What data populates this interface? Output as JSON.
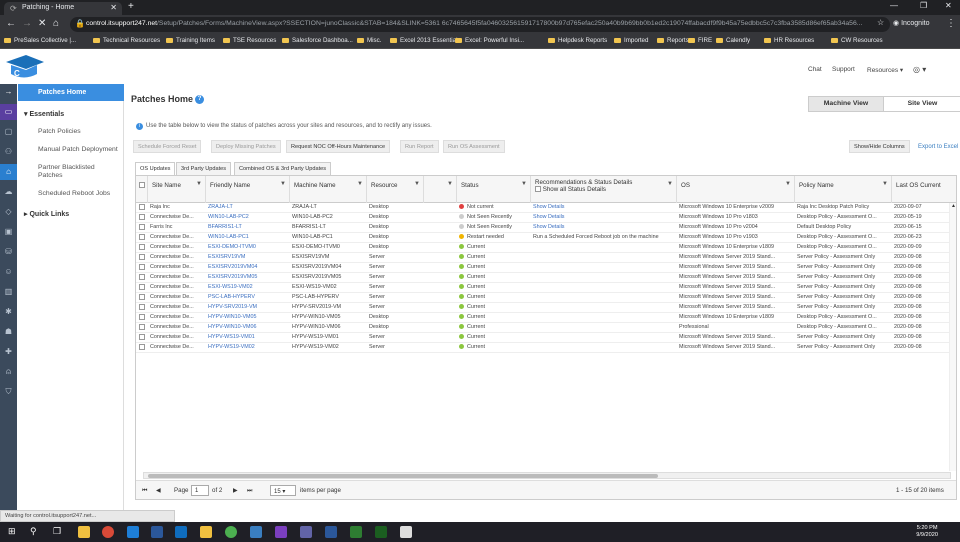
{
  "browser": {
    "tab_title": "Patching - Home",
    "tab_icon": "loading-icon",
    "new_tab_label": "+",
    "url_host": "control.itsupport247.net",
    "url_path": "/Setup/Patches/Forms/MachineView.aspx?SSECTION=junoClassic&STAB=184&SLINK=5361 6c7465645f5fa046032561591717800b97d765efac250a40b9b69bb0b1ed2c19074ffabacdf9f9b45a75edbbc5c7c3fba3585d86ef65ab34a56...",
    "profile": "Incognito",
    "bookmarks": [
      "PreSales Collective |...",
      "Technical Resources",
      "Training Items",
      "TSE Resources",
      "Salesforce Dashboa...",
      "Misc.",
      "Excel 2013 Essential...",
      "Excel: Powerful Insi...",
      "Helpdesk Reports",
      "Imported",
      "Reports",
      "FIRE",
      "Calendly",
      "HR Resources",
      "CW Resources"
    ],
    "status_text": "Waiting for control.itsupport247.net..."
  },
  "topnav": {
    "chat": "Chat",
    "support": "Support",
    "resources": "Resources ▾"
  },
  "sidenav": {
    "patches_home": "Patches Home",
    "essentials": "Essentials",
    "items": [
      "Patch Policies",
      "Manual Patch Deployment",
      "Partner Blacklisted Patches",
      "Scheduled Reboot Jobs"
    ],
    "quick_links": "Quick Links"
  },
  "main": {
    "title": "Patches Home",
    "view_machine": "Machine View",
    "view_site": "Site View",
    "info": "Use the table below to view the status of patches across your sites and resources, and to rectify any issues.",
    "buttons": [
      "Schedule Forced Reset",
      "Deploy Missing Patches",
      "Request NOC Off-Hours Maintenance",
      "Run Report",
      "Run OS Assessment"
    ],
    "show_hide": "Show/Hide Columns",
    "export": "Export to Excel",
    "tabs": [
      "OS Updates",
      "3rd Party Updates",
      "Combined OS & 3rd Party Updates"
    ]
  },
  "grid": {
    "headers": [
      "Site Name",
      "Friendly Name",
      "Machine Name",
      "Resource",
      "",
      "Status",
      "Recommendations & Status Details",
      "OS",
      "Policy Name",
      "Last OS Current"
    ],
    "show_all_status": "Show all Status Details",
    "rows": [
      {
        "site": "Raja Inc",
        "friendly": "ZRAJA-LT",
        "machine": "ZRAJA-LT",
        "resource": "Desktop",
        "status": "Not current",
        "status_color": "#e04040",
        "rec": "Show Details",
        "rec_link": true,
        "os": "Microsoft Windows 10 Enterprise v2009",
        "policy": "Raja Inc Desktop Patch Policy",
        "last": "2020-09-07"
      },
      {
        "site": "Connectwise De...",
        "friendly": "WIN10-LAB-PC2",
        "machine": "WIN10-LAB-PC2",
        "resource": "Desktop",
        "status": "Not Seen Recently",
        "status_color": "#cccccc",
        "rec": "Show Details",
        "rec_link": true,
        "os": "Microsoft Windows 10 Pro v1803",
        "policy": "Desktop Policy - Assessment O...",
        "last": "2020-05-19"
      },
      {
        "site": "Farris Inc",
        "friendly": "BFARRIS1-LT",
        "machine": "BFARRIS1-LT",
        "resource": "Desktop",
        "status": "Not Seen Recently",
        "status_color": "#cccccc",
        "rec": "Show Details",
        "rec_link": true,
        "os": "Microsoft Windows 10 Pro v2004",
        "policy": "Default Desktop Policy",
        "last": "2020-06-15"
      },
      {
        "site": "Connectwise De...",
        "friendly": "WIN10-LAB-PC1",
        "machine": "WIN10-LAB-PC1",
        "resource": "Desktop",
        "status": "Restart needed",
        "status_color": "#f0b400",
        "rec": "Run a Scheduled Forced Reboot job on the machine",
        "rec_link": false,
        "os": "Microsoft Windows 10 Pro v1903",
        "policy": "Desktop Policy - Assessment O...",
        "last": "2020-06-23"
      },
      {
        "site": "Connectwise De...",
        "friendly": "ESXI-DEMO-ITVM0",
        "machine": "ESXI-DEMO-ITVM0",
        "resource": "Desktop",
        "status": "Current",
        "status_color": "#8cc63f",
        "rec": "",
        "rec_link": false,
        "os": "Microsoft Windows 10 Enterprise v1809",
        "policy": "Desktop Policy - Assessment O...",
        "last": "2020-09-09"
      },
      {
        "site": "Connectwise De...",
        "friendly": "ESXISRV19VM",
        "machine": "ESXISRV19VM",
        "resource": "Server",
        "status": "Current",
        "status_color": "#8cc63f",
        "rec": "",
        "rec_link": false,
        "os": "Microsoft Windows Server 2019 Stand...",
        "policy": "Server Policy - Assessment Only",
        "last": "2020-09-08"
      },
      {
        "site": "Connectwise De...",
        "friendly": "ESXISRV2019VM04",
        "machine": "ESXISRV2019VM04",
        "resource": "Server",
        "status": "Current",
        "status_color": "#8cc63f",
        "rec": "",
        "rec_link": false,
        "os": "Microsoft Windows Server 2019 Stand...",
        "policy": "Server Policy - Assessment Only",
        "last": "2020-09-08"
      },
      {
        "site": "Connectwise De...",
        "friendly": "ESXISRV2019VM05",
        "machine": "ESXISRV2019VM05",
        "resource": "Server",
        "status": "Current",
        "status_color": "#8cc63f",
        "rec": "",
        "rec_link": false,
        "os": "Microsoft Windows Server 2019 Stand...",
        "policy": "Server Policy - Assessment Only",
        "last": "2020-09-08"
      },
      {
        "site": "Connectwise De...",
        "friendly": "ESXI-WS19-VM02",
        "machine": "ESXI-WS19-VM02",
        "resource": "Server",
        "status": "Current",
        "status_color": "#8cc63f",
        "rec": "",
        "rec_link": false,
        "os": "Microsoft Windows Server 2019 Stand...",
        "policy": "Server Policy - Assessment Only",
        "last": "2020-09-08"
      },
      {
        "site": "Connectwise De...",
        "friendly": "PSC-LAB-HYPERV",
        "machine": "PSC-LAB-HYPERV",
        "resource": "Server",
        "status": "Current",
        "status_color": "#8cc63f",
        "rec": "",
        "rec_link": false,
        "os": "Microsoft Windows Server 2019 Stand...",
        "policy": "Server Policy - Assessment Only",
        "last": "2020-09-08"
      },
      {
        "site": "Connectwise De...",
        "friendly": "HYPV-SRV2019-VM",
        "machine": "HYPV-SRV2019-VM",
        "resource": "Server",
        "status": "Current",
        "status_color": "#8cc63f",
        "rec": "",
        "rec_link": false,
        "os": "Microsoft Windows Server 2019 Stand...",
        "policy": "Server Policy - Assessment Only",
        "last": "2020-09-08"
      },
      {
        "site": "Connectwise De...",
        "friendly": "HYPV-WIN10-VM05",
        "machine": "HYPV-WIN10-VM05",
        "resource": "Desktop",
        "status": "Current",
        "status_color": "#8cc63f",
        "rec": "",
        "rec_link": false,
        "os": "Microsoft Windows 10 Enterprise v1809",
        "policy": "Desktop Policy - Assessment O...",
        "last": "2020-09-08"
      },
      {
        "site": "Connectwise De...",
        "friendly": "HYPV-WIN10-VM06",
        "machine": "HYPV-WIN10-VM06",
        "resource": "Desktop",
        "status": "Current",
        "status_color": "#8cc63f",
        "rec": "",
        "rec_link": false,
        "os": "Professional",
        "policy": "Desktop Policy - Assessment O...",
        "last": "2020-09-08"
      },
      {
        "site": "Connectwise De...",
        "friendly": "HYPV-WS19-VM01",
        "machine": "HYPV-WS19-VM01",
        "resource": "Server",
        "status": "Current",
        "status_color": "#8cc63f",
        "rec": "",
        "rec_link": false,
        "os": "Microsoft Windows Server 2019 Stand...",
        "policy": "Server Policy - Assessment Only",
        "last": "2020-09-08"
      },
      {
        "site": "Connectwise De...",
        "friendly": "HYPV-WS19-VM02",
        "machine": "HYPV-WS19-VM02",
        "resource": "Server",
        "status": "Current",
        "status_color": "#8cc63f",
        "rec": "",
        "rec_link": false,
        "os": "Microsoft Windows Server 2019 Stand...",
        "policy": "Server Policy - Assessment Only",
        "last": "2020-09-08"
      }
    ],
    "pager": {
      "page_label": "Page",
      "page": "1",
      "of": "of 2",
      "page_size": "15 ▾",
      "items_per_page": "items per page",
      "summary": "1 - 15 of 20 items"
    }
  },
  "taskbar": {
    "time": "5:20 PM",
    "date": "9/9/2020"
  },
  "colors": {
    "accent": "#3a8ee0",
    "nav_bg": "#3b4a5c",
    "chrome_bg": "#35363a"
  }
}
